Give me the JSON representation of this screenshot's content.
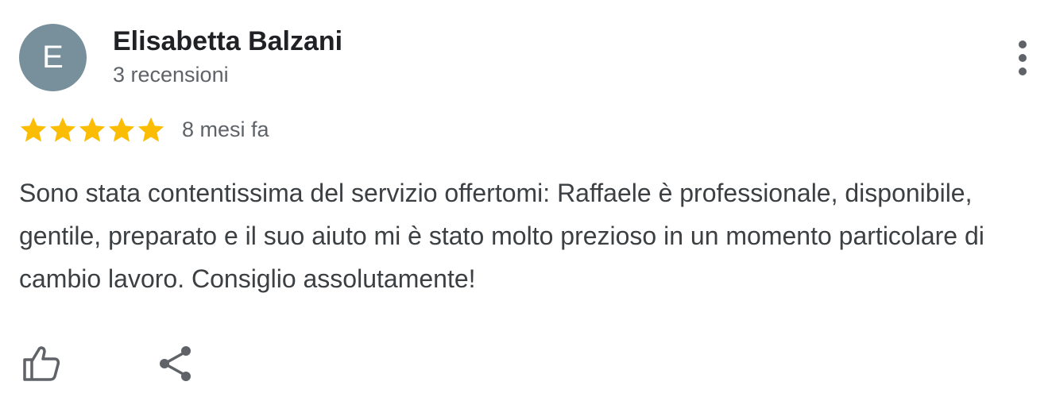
{
  "review": {
    "author": {
      "initial": "E",
      "name": "Elisabetta Balzani",
      "review_count": "3 recensioni",
      "avatar_color": "#78909c"
    },
    "rating": 5,
    "max_rating": 5,
    "star_color": "#fbbc04",
    "date": "8 mesi fa",
    "text": "Sono stata contentissima del servizio offertomi: Raffaele è professionale, disponibile, gentile, preparato e il suo aiuto mi è stato molto prezioso in un momento particolare di cambio lavoro. Consiglio assolutamente!"
  },
  "icons": {
    "menu": "more-vert-icon",
    "like": "thumb-up-icon",
    "share": "share-icon",
    "star": "star-icon"
  }
}
